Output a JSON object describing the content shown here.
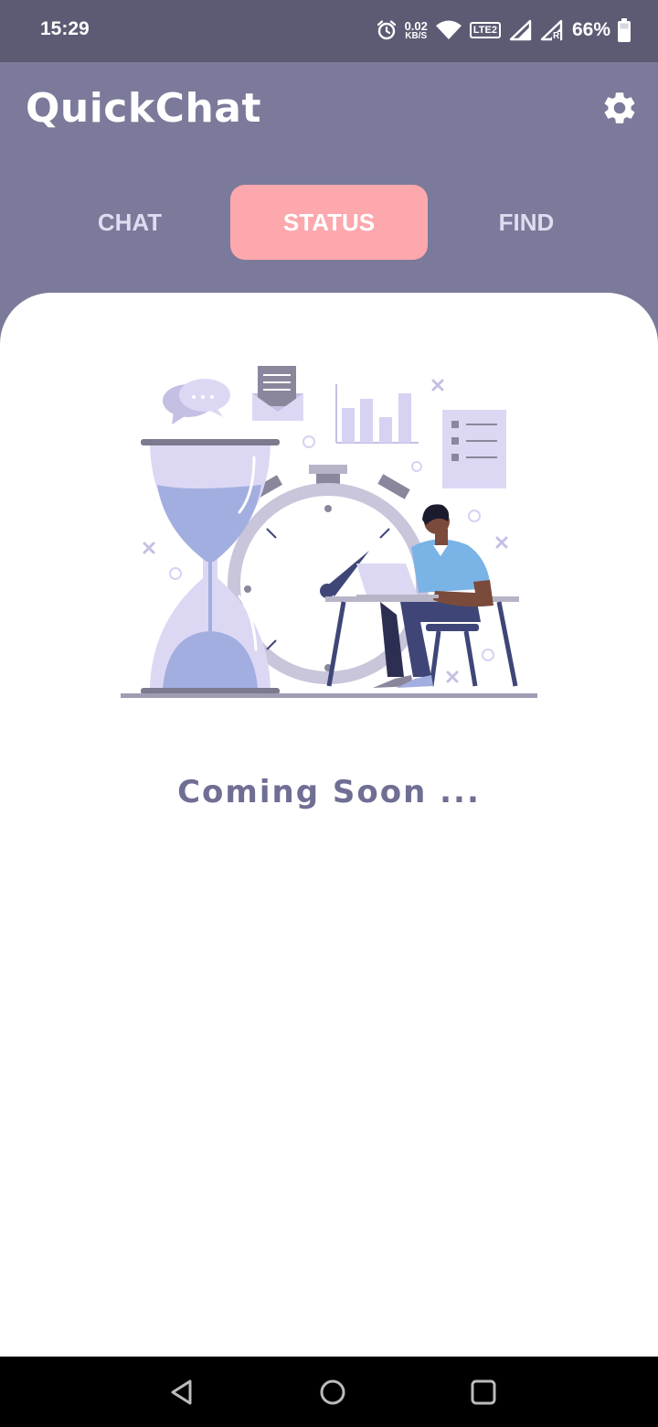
{
  "statusbar": {
    "time": "15:29",
    "net_speed_value": "0.02",
    "net_speed_unit": "KB/S",
    "volte_label": "LTE2",
    "roaming_label": "R",
    "battery_percent": "66%",
    "icons": [
      "alarm-icon",
      "wifi-icon",
      "volte-icon",
      "signal-icon",
      "signal-roaming-icon",
      "battery-icon"
    ]
  },
  "app": {
    "title": "QuickChat",
    "settings_icon": "gear-icon"
  },
  "tabs": [
    {
      "label": "CHAT",
      "active": false
    },
    {
      "label": "STATUS",
      "active": true
    },
    {
      "label": "FIND",
      "active": false
    }
  ],
  "content": {
    "illustration": "hourglass-stopwatch-person-at-laptop-illustration",
    "message": "Coming Soon ..."
  },
  "navbar": {
    "icons": [
      "back-icon",
      "home-icon",
      "recents-icon"
    ]
  },
  "colors": {
    "statusbar_bg": "#5c5b73",
    "appbar_bg": "#7b7a9a",
    "active_tab_bg": "#fca8ad",
    "message_text": "#6f6e93"
  }
}
